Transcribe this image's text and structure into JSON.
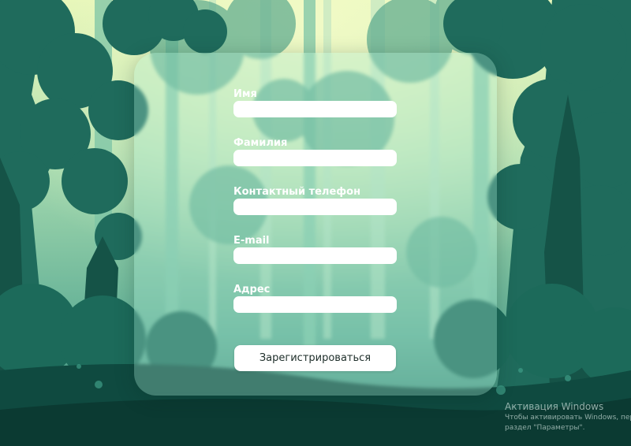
{
  "form": {
    "fields": [
      {
        "label": "Имя",
        "value": ""
      },
      {
        "label": "Фамилия",
        "value": ""
      },
      {
        "label": "Контактный телефон",
        "value": ""
      },
      {
        "label": "E-mail",
        "value": ""
      },
      {
        "label": "Адрес",
        "value": ""
      }
    ],
    "submit_label": "Зарегистрироваться"
  },
  "watermark": {
    "title": "Активация Windows",
    "line1": "Чтобы активировать Windows, перей",
    "line2": "раздел \"Параметры\"."
  },
  "colors": {
    "sky": "#d9f2b8",
    "forest_mid": "#6fb89a",
    "forest_dark": "#1f6b5c",
    "forest_deep": "#0f4a40",
    "ground": "#0d3d35",
    "panel": "#aae8d4",
    "input_bg": "#ffffff",
    "label_text": "#ffffff"
  },
  "background_icon": "forest-illustration"
}
